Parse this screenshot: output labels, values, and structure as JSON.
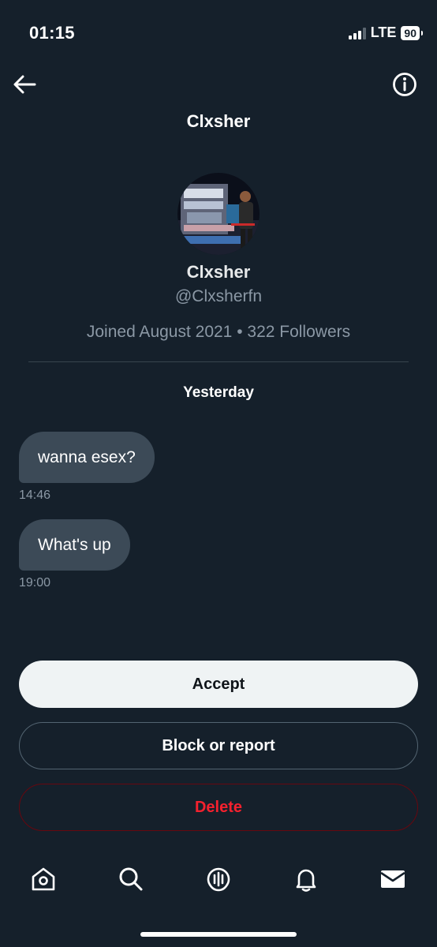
{
  "status_bar": {
    "time": "01:15",
    "network": "LTE",
    "battery": "90"
  },
  "header": {
    "title": "Clxsher"
  },
  "profile": {
    "name": "Clxsher",
    "handle": "@Clxsherfn",
    "meta": "Joined August 2021 • 322 Followers"
  },
  "conversation": {
    "day_label": "Yesterday",
    "messages": [
      {
        "text": "wanna esex?",
        "time": "14:46"
      },
      {
        "text": "What's up",
        "time": "19:00"
      }
    ]
  },
  "actions": {
    "accept": "Accept",
    "block": "Block or report",
    "delete": "Delete"
  },
  "tabbar": {
    "tabs": [
      "home-icon",
      "search-icon",
      "spaces-icon",
      "notifications-icon",
      "messages-icon"
    ]
  },
  "colors": {
    "background": "#15202b",
    "bubble": "#3c4a57",
    "delete": "#f4212e",
    "muted": "#8b98a5"
  }
}
